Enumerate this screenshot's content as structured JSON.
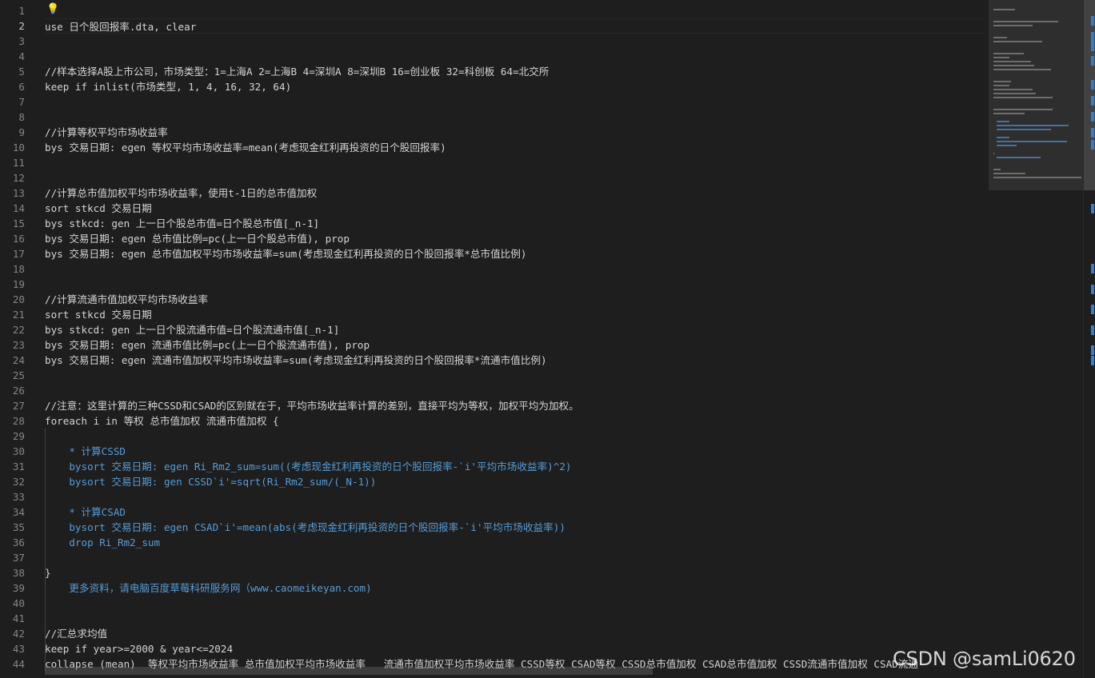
{
  "editor": {
    "language": "stata",
    "active_line": 2,
    "lines": [
      {
        "n": "1",
        "text": ""
      },
      {
        "n": "2",
        "text": "use 日个股回报率.dta, clear"
      },
      {
        "n": "3",
        "text": ""
      },
      {
        "n": "4",
        "text": ""
      },
      {
        "n": "5",
        "text": "//样本选择A股上市公司，市场类型：1=上海A 2=上海B 4=深圳A 8=深圳B 16=创业板 32=科创板 64=北交所"
      },
      {
        "n": "6",
        "text": "keep if inlist(市场类型, 1, 4, 16, 32, 64)"
      },
      {
        "n": "7",
        "text": ""
      },
      {
        "n": "8",
        "text": ""
      },
      {
        "n": "9",
        "text": "//计算等权平均市场收益率"
      },
      {
        "n": "10",
        "text": "bys 交易日期: egen 等权平均市场收益率=mean(考虑现金红利再投资的日个股回报率)"
      },
      {
        "n": "11",
        "text": ""
      },
      {
        "n": "12",
        "text": ""
      },
      {
        "n": "13",
        "text": "//计算总市值加权平均市场收益率，使用t-1日的总市值加权"
      },
      {
        "n": "14",
        "text": "sort stkcd 交易日期"
      },
      {
        "n": "15",
        "text": "bys stkcd: gen 上一日个股总市值=日个股总市值[_n-1]"
      },
      {
        "n": "16",
        "text": "bys 交易日期: egen 总市值比例=pc(上一日个股总市值), prop"
      },
      {
        "n": "17",
        "text": "bys 交易日期: egen 总市值加权平均市场收益率=sum(考虑现金红利再投资的日个股回报率*总市值比例)"
      },
      {
        "n": "18",
        "text": ""
      },
      {
        "n": "19",
        "text": ""
      },
      {
        "n": "20",
        "text": "//计算流通市值加权平均市场收益率"
      },
      {
        "n": "21",
        "text": "sort stkcd 交易日期"
      },
      {
        "n": "22",
        "text": "bys stkcd: gen 上一日个股流通市值=日个股流通市值[_n-1]"
      },
      {
        "n": "23",
        "text": "bys 交易日期: egen 流通市值比例=pc(上一日个股流通市值), prop"
      },
      {
        "n": "24",
        "text": "bys 交易日期: egen 流通市值加权平均市场收益率=sum(考虑现金红利再投资的日个股回报率*流通市值比例)"
      },
      {
        "n": "25",
        "text": ""
      },
      {
        "n": "26",
        "text": ""
      },
      {
        "n": "27",
        "text": "//注意：这里计算的三种CSSD和CSAD的区别就在于，平均市场收益率计算的差别，直接平均为等权，加权平均为加权。"
      },
      {
        "n": "28",
        "text": "foreach i in 等权 总市值加权 流通市值加权 {"
      },
      {
        "n": "29",
        "text": ""
      },
      {
        "n": "30",
        "text": "    * 计算CSSD"
      },
      {
        "n": "31",
        "text": "    bysort 交易日期: egen Ri_Rm2_sum=sum((考虑现金红利再投资的日个股回报率-`i'平均市场收益率)^2)"
      },
      {
        "n": "32",
        "text": "    bysort 交易日期: gen CSSD`i'=sqrt(Ri_Rm2_sum/(_N-1))"
      },
      {
        "n": "33",
        "text": ""
      },
      {
        "n": "34",
        "text": "    * 计算CSAD"
      },
      {
        "n": "35",
        "text": "    bysort 交易日期: egen CSAD`i'=mean(abs(考虑现金红利再投资的日个股回报率-`i'平均市场收益率))"
      },
      {
        "n": "36",
        "text": "    drop Ri_Rm2_sum"
      },
      {
        "n": "37",
        "text": ""
      },
      {
        "n": "38",
        "text": "}"
      },
      {
        "n": "39",
        "text": "    更多资料，请电脑百度草莓科研服务网（www.caomeikeyan.com)"
      },
      {
        "n": "40",
        "text": ""
      },
      {
        "n": "41",
        "text": ""
      },
      {
        "n": "42",
        "text": "//汇总求均值"
      },
      {
        "n": "43",
        "text": "keep if year>=2000 & year<=2024"
      },
      {
        "n": "44",
        "text": "collapse (mean)  等权平均市场收益率 总市值加权平均市场收益率   流通市值加权平均市场收益率 CSSD等权 CSAD等权 CSSD总市值加权 CSAD总市值加权 CSSD流通市值加权 CSAD流通"
      }
    ]
  },
  "watermark": "CSDN @samLi0620",
  "icons": {
    "lightbulb": "lightbulb-icon"
  },
  "colors": {
    "background": "#1e1e1e",
    "text": "#d4d4d4",
    "blue": "#569cd6",
    "line_number": "#858585"
  }
}
